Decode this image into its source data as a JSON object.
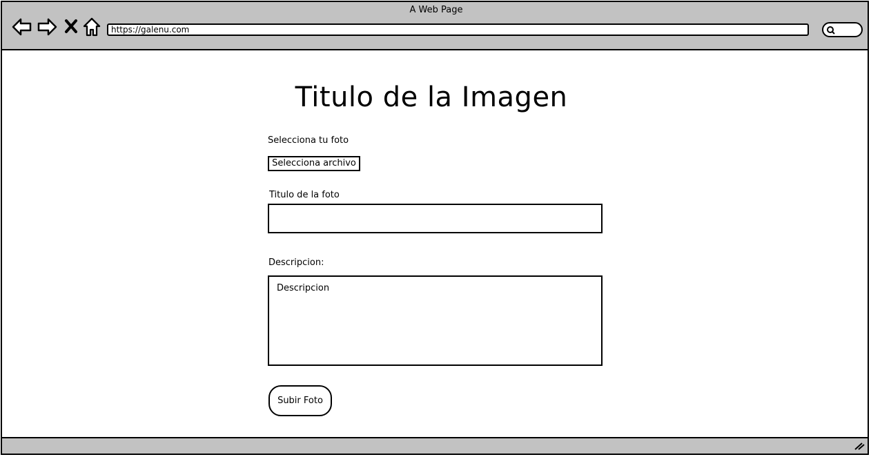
{
  "window": {
    "title": "A Web Page"
  },
  "browser": {
    "url": "https://galenu.com"
  },
  "page": {
    "title": "Titulo de la Imagen",
    "photo_label": "Selecciona tu foto",
    "file_button": "Selecciona archivo",
    "title_label": "Titulo de la foto",
    "title_value": "",
    "description_label": "Descripcion:",
    "description_placeholder": "Descripcion",
    "submit_label": "Subir Foto"
  },
  "icons": [
    "back-icon",
    "forward-icon",
    "close-icon",
    "home-icon",
    "search-icon",
    "resize-icon"
  ]
}
